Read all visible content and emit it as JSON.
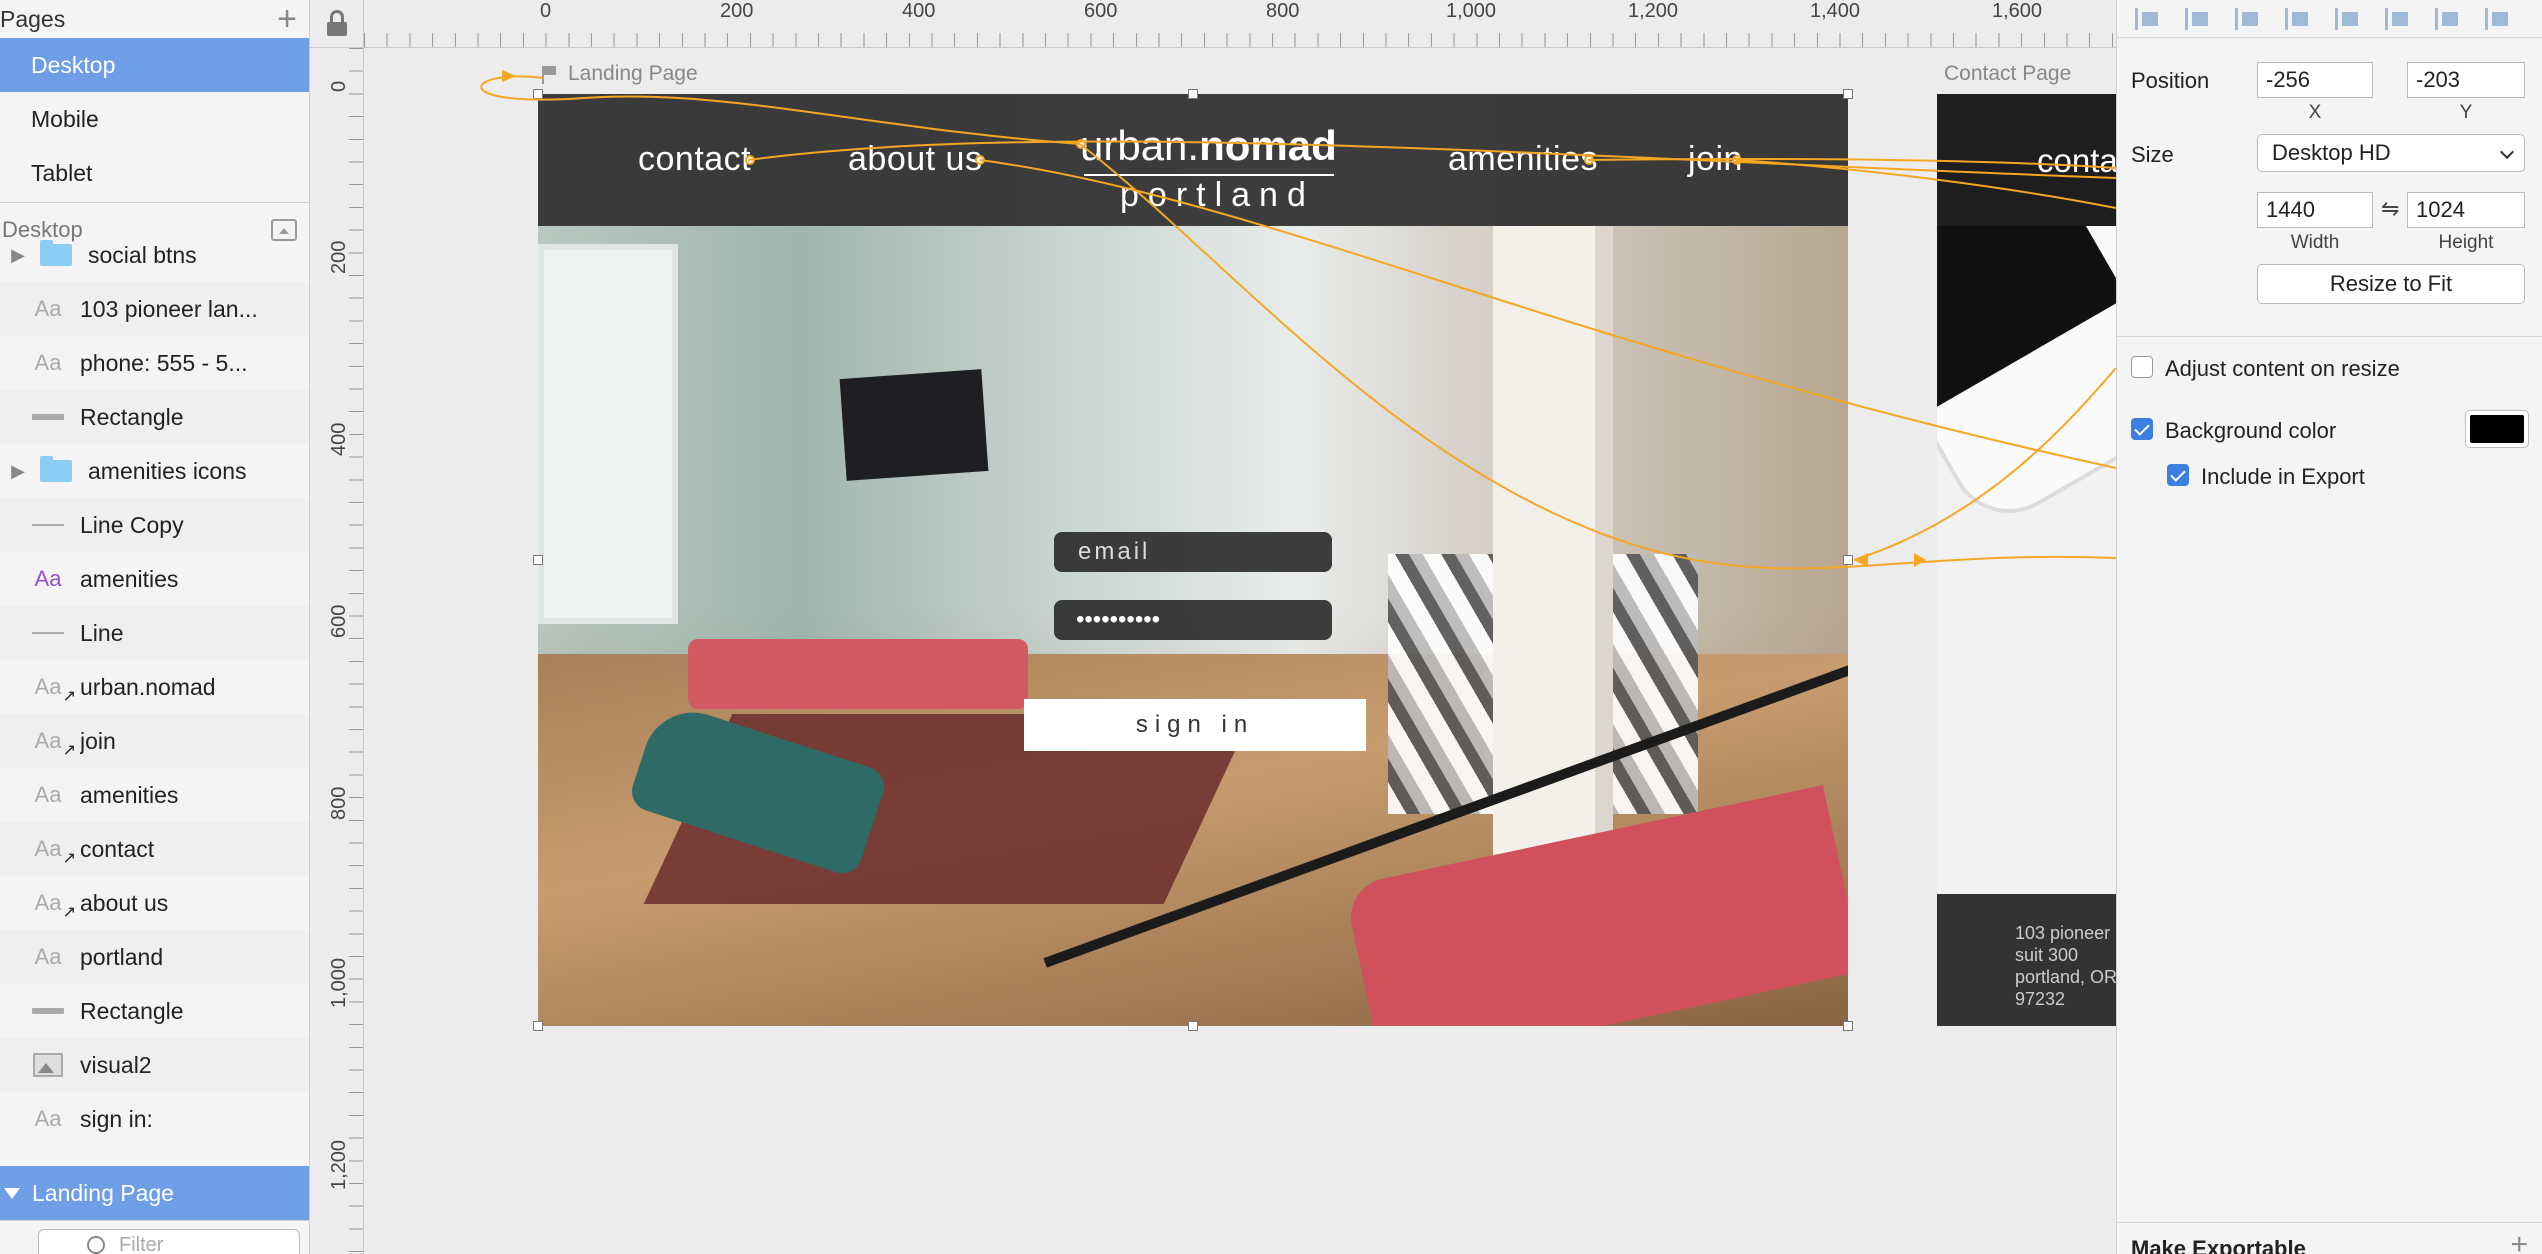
{
  "pages": {
    "header": "Pages",
    "items": [
      {
        "label": "Desktop",
        "selected": true
      },
      {
        "label": "Mobile",
        "selected": false
      },
      {
        "label": "Tablet",
        "selected": false
      }
    ]
  },
  "layers": {
    "section_title": "Desktop",
    "items": [
      {
        "label": "social btns",
        "icon": "folder-icon",
        "expandable": true
      },
      {
        "label": "103 pioneer lan...",
        "icon": "text-icon"
      },
      {
        "label": "phone: 555 - 5...",
        "icon": "text-icon"
      },
      {
        "label": "Rectangle",
        "icon": "rectangle-icon"
      },
      {
        "label": "amenities icons",
        "icon": "folder-icon",
        "expandable": true
      },
      {
        "label": "Line Copy",
        "icon": "line-icon"
      },
      {
        "label": "amenities",
        "icon": "text-icon-highlighted"
      },
      {
        "label": "Line",
        "icon": "line-icon"
      },
      {
        "label": "urban.nomad",
        "icon": "text-hotspot-icon"
      },
      {
        "label": "join",
        "icon": "text-hotspot-icon"
      },
      {
        "label": "amenities",
        "icon": "text-icon"
      },
      {
        "label": "contact",
        "icon": "text-hotspot-icon"
      },
      {
        "label": "about us",
        "icon": "text-hotspot-icon"
      },
      {
        "label": "portland",
        "icon": "text-icon"
      },
      {
        "label": "Rectangle",
        "icon": "rectangle-icon"
      },
      {
        "label": "visual2",
        "icon": "image-icon"
      },
      {
        "label": "sign in:",
        "icon": "text-icon"
      }
    ],
    "artboard_row": "Landing Page",
    "filter_placeholder": "Filter",
    "text_glyph": "Aa"
  },
  "ruler": {
    "top_labels": [
      "0",
      "200",
      "400",
      "600",
      "800",
      "1,000",
      "1,200",
      "1,400",
      "1,600"
    ],
    "left_labels": [
      "0",
      "200",
      "400",
      "600",
      "800",
      "1,000",
      "1,200"
    ]
  },
  "canvas": {
    "landing_title": "Landing Page",
    "contact_title": "Contact Page",
    "landing": {
      "nav_contact": "contact",
      "nav_about": "about us",
      "logo_light": "urban.",
      "logo_bold": "nomad",
      "logo_sub": "portland",
      "nav_amenities": "amenities",
      "nav_join": "join",
      "email_placeholder": "email",
      "password_mask": "••••••••••",
      "signin_label": "sign in"
    },
    "contact": {
      "nav_partial": "conta",
      "address_lines": [
        "103 pioneer",
        "suit 300",
        "portland, OR",
        "97232"
      ]
    },
    "wire_color": "#f5a623"
  },
  "inspector": {
    "position_label": "Position",
    "x_value": "-256",
    "y_value": "-203",
    "x_label": "X",
    "y_label": "Y",
    "size_label": "Size",
    "size_preset": "Desktop HD",
    "width_value": "1440",
    "height_value": "1024",
    "width_label": "Width",
    "height_label": "Height",
    "link_glyph": "⇋",
    "resize_button": "Resize to Fit",
    "adjust_label": "Adjust content on resize",
    "adjust_checked": false,
    "bg_label": "Background color",
    "bg_checked": true,
    "bg_color": "#000000",
    "export_label": "Include in Export",
    "export_checked": true,
    "make_exportable": "Make Exportable"
  },
  "colors": {
    "selection_blue": "#6d9ee6",
    "checkbox_blue": "#3c7fe0",
    "prototype_orange": "#f5a623"
  }
}
